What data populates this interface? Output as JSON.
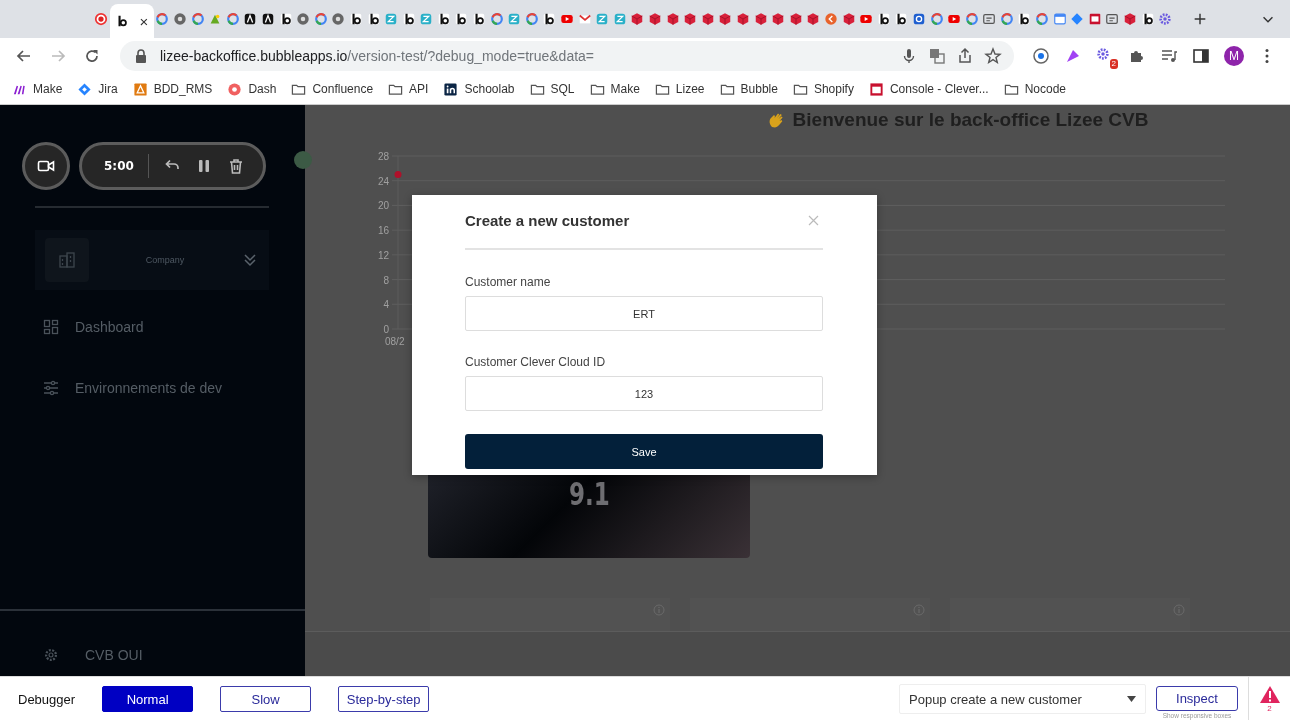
{
  "browser": {
    "tabs": [
      {
        "kind": "record",
        "selected": false
      },
      {
        "kind": "bubble",
        "selected": true
      },
      {
        "kind": "google",
        "selected": false
      },
      {
        "kind": "chrome",
        "selected": false
      },
      {
        "kind": "google",
        "selected": false
      },
      {
        "kind": "green",
        "selected": false
      },
      {
        "kind": "google",
        "selected": false
      },
      {
        "kind": "dark",
        "selected": false
      },
      {
        "kind": "dark",
        "selected": false
      },
      {
        "kind": "bubble",
        "selected": false
      },
      {
        "kind": "chrome",
        "selected": false
      },
      {
        "kind": "google",
        "selected": false
      },
      {
        "kind": "chrome",
        "selected": false
      },
      {
        "kind": "bubble",
        "selected": false
      },
      {
        "kind": "bubble",
        "selected": false
      },
      {
        "kind": "teal",
        "selected": false
      },
      {
        "kind": "bubble",
        "selected": false
      },
      {
        "kind": "teal",
        "selected": false
      },
      {
        "kind": "bubble",
        "selected": false
      },
      {
        "kind": "bubble",
        "selected": false
      },
      {
        "kind": "bubble",
        "selected": false
      },
      {
        "kind": "google",
        "selected": false
      },
      {
        "kind": "teal",
        "selected": false
      },
      {
        "kind": "google",
        "selected": false
      },
      {
        "kind": "bubble",
        "selected": false
      },
      {
        "kind": "youtube",
        "selected": false
      },
      {
        "kind": "gmail",
        "selected": false
      },
      {
        "kind": "teal",
        "selected": false
      },
      {
        "kind": "teal",
        "selected": false
      },
      {
        "kind": "red",
        "selected": false
      },
      {
        "kind": "red",
        "selected": false
      },
      {
        "kind": "red",
        "selected": false
      },
      {
        "kind": "red",
        "selected": false
      },
      {
        "kind": "red",
        "selected": false
      },
      {
        "kind": "red",
        "selected": false
      },
      {
        "kind": "red",
        "selected": false
      },
      {
        "kind": "red",
        "selected": false
      },
      {
        "kind": "red",
        "selected": false
      },
      {
        "kind": "red",
        "selected": false
      },
      {
        "kind": "red",
        "selected": false
      },
      {
        "kind": "orange",
        "selected": false
      },
      {
        "kind": "red",
        "selected": false
      },
      {
        "kind": "youtube",
        "selected": false
      },
      {
        "kind": "bubble",
        "selected": false
      },
      {
        "kind": "bubble",
        "selected": false
      },
      {
        "kind": "blue",
        "selected": false
      },
      {
        "kind": "google",
        "selected": false
      },
      {
        "kind": "youtube",
        "selected": false
      },
      {
        "kind": "google",
        "selected": false
      },
      {
        "kind": "generic",
        "selected": false
      },
      {
        "kind": "google",
        "selected": false
      },
      {
        "kind": "bubble",
        "selected": false
      },
      {
        "kind": "google",
        "selected": false
      },
      {
        "kind": "calendar",
        "selected": false
      },
      {
        "kind": "diamond",
        "selected": false
      },
      {
        "kind": "redsquare",
        "selected": false
      },
      {
        "kind": "generic",
        "selected": false
      },
      {
        "kind": "red",
        "selected": false
      },
      {
        "kind": "bubble",
        "selected": false
      },
      {
        "kind": "gear",
        "selected": false
      }
    ],
    "active_tab_close": "×",
    "address": {
      "host": "lizee-backoffice.bubbleapps.io",
      "path": "/version-test/?debug_mode=true&data="
    },
    "extension_badge": "2",
    "profile_initial": "M",
    "bookmarks": [
      {
        "label": "Make",
        "kind": "make"
      },
      {
        "label": "Jira",
        "kind": "jira"
      },
      {
        "label": "BDD_RMS",
        "kind": "bdd"
      },
      {
        "label": "Dash",
        "kind": "dash"
      },
      {
        "label": "Confluence",
        "kind": "folder"
      },
      {
        "label": "API",
        "kind": "folder"
      },
      {
        "label": "Schoolab",
        "kind": "linkedin"
      },
      {
        "label": "SQL",
        "kind": "folder"
      },
      {
        "label": "Make",
        "kind": "folder"
      },
      {
        "label": "Lizee",
        "kind": "folder"
      },
      {
        "label": "Bubble",
        "kind": "folder"
      },
      {
        "label": "Shopify",
        "kind": "folder"
      },
      {
        "label": "Console - Clever...",
        "kind": "console"
      },
      {
        "label": "Nocode",
        "kind": "folder"
      }
    ]
  },
  "sidebar": {
    "recorder": {
      "timer": "5:00"
    },
    "company_selector": {
      "label": "Company"
    },
    "nav": [
      {
        "label": "Dashboard",
        "kind": "grid"
      },
      {
        "label": "Environnements de dev",
        "kind": "sliders"
      }
    ],
    "footer": {
      "label": "CVB OUI"
    }
  },
  "main": {
    "title": "Bienvenue sur le back-office Lizee CVB",
    "chart_data": {
      "type": "line",
      "categories": [
        "08/2"
      ],
      "series": [
        {
          "color": "#b0102a",
          "values": [
            25
          ],
          "marker": true
        }
      ],
      "ylim": [
        0,
        28
      ],
      "yticks": [
        0,
        4,
        8,
        12,
        16,
        20,
        24,
        28
      ],
      "grid": true
    },
    "score_card": {
      "value": "9.1"
    },
    "stat_cards": [
      {
        "kind": "info"
      },
      {
        "kind": "info"
      },
      {
        "kind": "info"
      }
    ]
  },
  "modal": {
    "title": "Create a new customer",
    "fields": [
      {
        "label": "Customer name",
        "value": "ERT"
      },
      {
        "label": "Customer Clever Cloud ID",
        "value": "123"
      }
    ],
    "submit": "Save"
  },
  "debugger": {
    "label": "Debugger",
    "modes": [
      {
        "label": "Normal",
        "selected": true
      },
      {
        "label": "Slow",
        "selected": false
      },
      {
        "label": "Step-by-step",
        "selected": false
      }
    ],
    "element_select": {
      "value": "Popup create a new customer"
    },
    "inspect": "Inspect",
    "inspect_hint": "Show responsive boxes",
    "warning_count": "2"
  }
}
